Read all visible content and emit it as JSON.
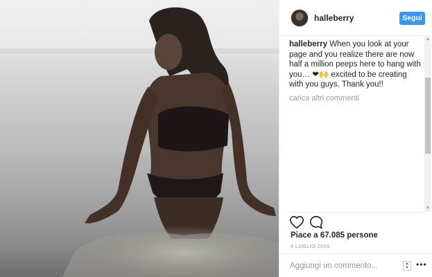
{
  "post": {
    "username": "halleberry",
    "follow_label": "Segui",
    "caption_user": "halleberry",
    "caption_text": "When you look at your page and you realize there are now half a million peeps here to hang with you… ❤🙌 excited to be creating with you guys. Thank you!!",
    "load_more_label": "carica altri commenti",
    "likes_text": "Piace a 67.085 persone",
    "date_text": "4 LUGLIO 2016",
    "comment_placeholder": "Aggiungi un commento...",
    "more_label": "•••"
  },
  "icons": {
    "like": "heart-outline-icon",
    "comment": "comment-bubble-icon",
    "more": "ellipsis-icon"
  },
  "colors": {
    "accent": "#3897f0",
    "text": "#262626",
    "muted": "#999999"
  }
}
